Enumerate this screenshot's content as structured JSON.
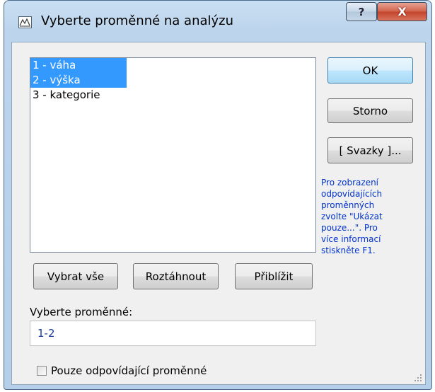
{
  "window": {
    "title": "Vyberte proměnné na analýzu",
    "help_glyph": "?",
    "close_glyph": "X"
  },
  "list": {
    "items": [
      {
        "label": "1 - váha",
        "selected": true
      },
      {
        "label": "2 - výška",
        "selected": true
      },
      {
        "label": "3 - kategorie",
        "selected": false
      }
    ]
  },
  "buttons": {
    "ok": "OK",
    "cancel": "Storno",
    "bundles": "[ Svazky ]...",
    "select_all": "Vybrat vše",
    "expand": "Roztáhnout",
    "zoom": "Přiblížit"
  },
  "hint": "Pro zobrazení\nodpovídajících\nproměnných\nzvolte \"Ukázat\npouze...\". Pro\nvíce informací\nstiskněte F1.",
  "field": {
    "label": "Vyberte proměnné:",
    "value": "1-2"
  },
  "checkbox": {
    "label": "Pouze odpovídající proměnné",
    "checked": false
  },
  "colors": {
    "selection": "#3399ff",
    "hint_text": "#0033cc",
    "field_text": "#1a3c9c"
  }
}
